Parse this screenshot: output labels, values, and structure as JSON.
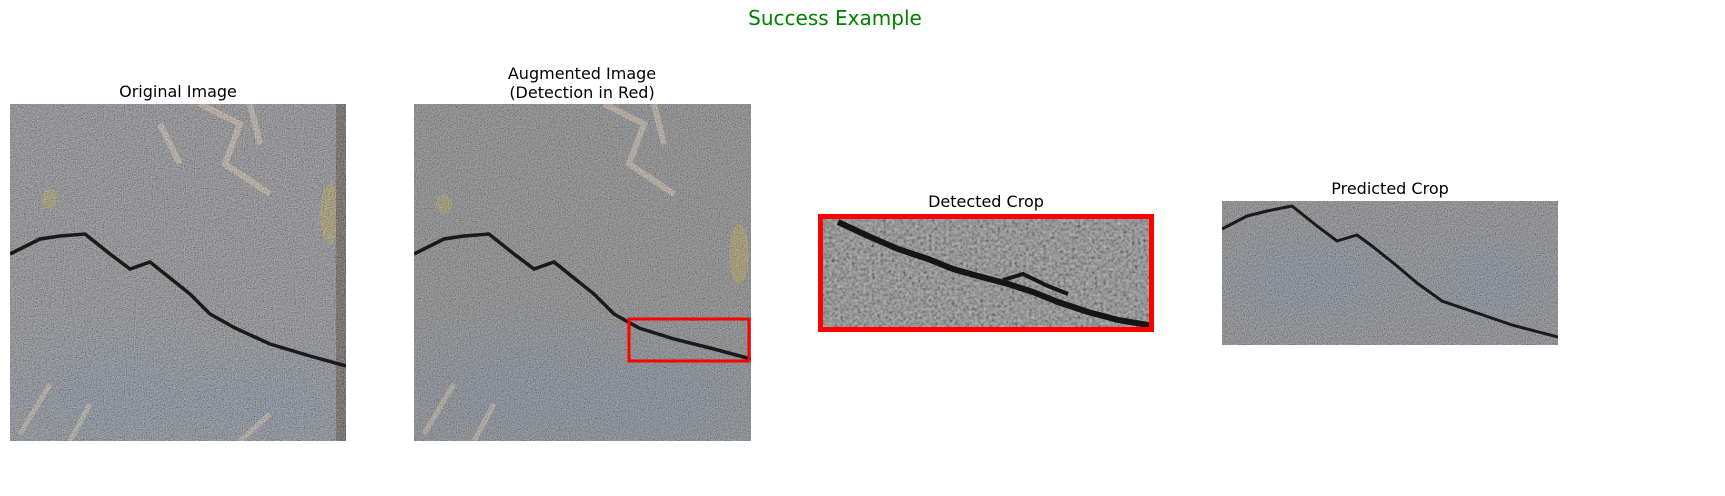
{
  "figure": {
    "suptitle": "Success Example",
    "suptitle_color": "#008000"
  },
  "panels": [
    {
      "title": "Original Image"
    },
    {
      "title_line1": "Augmented Image",
      "title_line2": "(Detection in Red)"
    },
    {
      "title": "Detected Crop"
    },
    {
      "title": "Predicted Crop"
    }
  ],
  "colors": {
    "detection_box": "#ff0000",
    "asphalt_gray": "#6f7074",
    "blue_stain": "#5b6f8c",
    "crack": "#1a1a1a",
    "beige_patch": "#c9b39a",
    "moss": "#9c8a3a"
  }
}
